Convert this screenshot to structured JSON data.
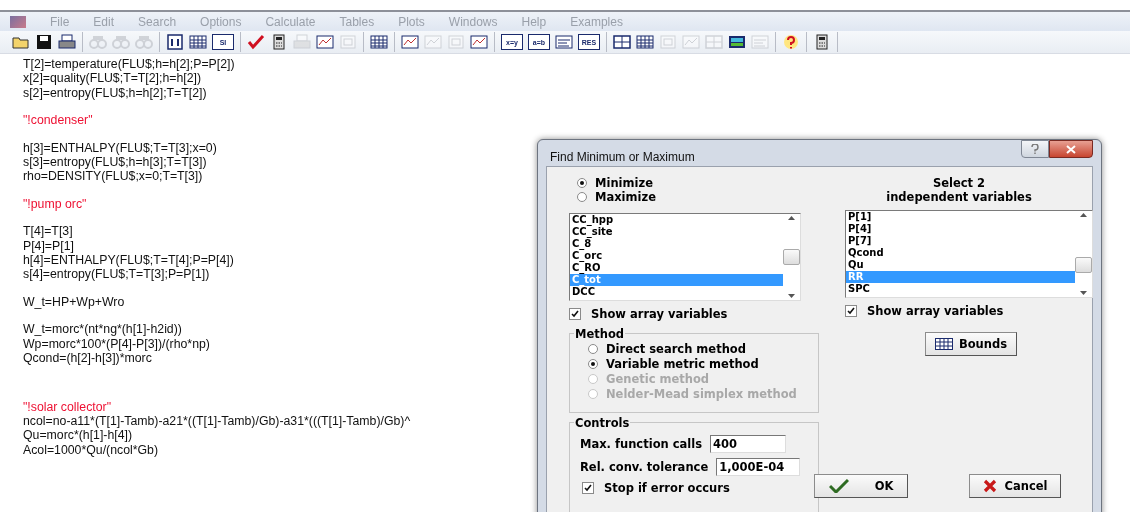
{
  "menu_bar": {
    "items": [
      "File",
      "Edit",
      "Search",
      "Options",
      "Calculate",
      "Tables",
      "Plots",
      "Windows",
      "Help",
      "Examples"
    ]
  },
  "toolbar": {
    "groups": [
      [
        {
          "kind": "folder",
          "disabled": false
        },
        {
          "kind": "disk",
          "disabled": false
        },
        {
          "kind": "printer",
          "disabled": false
        }
      ],
      [
        {
          "kind": "binoculars",
          "disabled": true
        },
        {
          "kind": "binoculars",
          "disabled": true
        },
        {
          "kind": "binoculars",
          "disabled": true
        }
      ],
      [
        {
          "kind": "dialog",
          "disabled": false
        },
        {
          "kind": "table",
          "disabled": false
        },
        {
          "kind": "labeled",
          "label": "SI",
          "disabled": false
        }
      ],
      [
        {
          "kind": "check",
          "disabled": false
        },
        {
          "kind": "calculator",
          "disabled": false
        },
        {
          "kind": "printer",
          "disabled": true
        },
        {
          "kind": "plot",
          "disabled": false
        },
        {
          "kind": "window",
          "disabled": true
        }
      ],
      [
        {
          "kind": "table",
          "disabled": false
        }
      ],
      [
        {
          "kind": "plot",
          "disabled": false
        },
        {
          "kind": "plot",
          "disabled": true
        },
        {
          "kind": "window",
          "disabled": true
        },
        {
          "kind": "plot",
          "disabled": false
        }
      ],
      [
        {
          "kind": "labeled",
          "label": "x=y",
          "disabled": false
        },
        {
          "kind": "labeled",
          "label": "a=b",
          "disabled": false
        },
        {
          "kind": "lines",
          "disabled": false
        },
        {
          "kind": "labeled",
          "label": "RES",
          "disabled": false
        }
      ],
      [
        {
          "kind": "grid",
          "disabled": false
        },
        {
          "kind": "table",
          "disabled": false
        },
        {
          "kind": "window",
          "disabled": true
        },
        {
          "kind": "plot",
          "disabled": true
        },
        {
          "kind": "grid",
          "disabled": true
        },
        {
          "kind": "picture",
          "disabled": false
        },
        {
          "kind": "lines",
          "disabled": true
        }
      ],
      [
        {
          "kind": "help",
          "disabled": false
        }
      ],
      [
        {
          "kind": "calculator",
          "disabled": false
        }
      ]
    ]
  },
  "code_blocks": [
    {
      "kind": "code",
      "lines": [
        "T[2]=temperature(FLU$;h=h[2];P=P[2])",
        "x[2]=quality(FLU$;T=T[2];h=h[2])",
        "s[2]=entropy(FLU$;h=h[2];T=T[2])"
      ]
    },
    {
      "kind": "comment",
      "lines": [
        "\"!condenser\""
      ]
    },
    {
      "kind": "code",
      "lines": [
        "h[3]=ENTHALPY(FLU$;T=T[3];x=0)",
        "s[3]=entropy(FLU$;h=h[3];T=T[3])",
        "rho=DENSITY(FLU$;x=0;T=T[3])"
      ]
    },
    {
      "kind": "comment",
      "lines": [
        "\"!pump orc\""
      ]
    },
    {
      "kind": "code",
      "lines": [
        "T[4]=T[3]",
        "P[4]=P[1]",
        "h[4]=ENTHALPY(FLU$;T=T[4];P=P[4])",
        "s[4]=entropy(FLU$;T=T[3];P=P[1])"
      ]
    },
    {
      "kind": "code",
      "lines": [
        "W_t=HP+Wp+Wro"
      ]
    },
    {
      "kind": "code",
      "lines": [
        "W_t=morc*(nt*ng*(h[1]-h2id))",
        "Wp=morc*100*(P[4]-P[3])/(rho*np)",
        "Qcond=(h[2]-h[3])*morc"
      ]
    },
    {
      "kind": "comment",
      "lines": [
        "\"!solar collector\""
      ]
    },
    {
      "kind": "code",
      "lines": [
        "ncol=no-a11*(T[1]-Tamb)-a21*((T[1]-Tamb)/Gb)-a31*(((T[1]-Tamb)/Gb)^",
        "Qu=morc*(h[1]-h[4])",
        "Acol=1000*Qu/(ncol*Gb)"
      ]
    }
  ],
  "dialog": {
    "title": "Find Minimum or Maximum",
    "objective": [
      {
        "label": "Minimize",
        "selected": true
      },
      {
        "label": "Maximize",
        "selected": false
      }
    ],
    "select_title": [
      "Select 2",
      "independent variables"
    ],
    "objective_list": {
      "items": [
        {
          "label": "CC_hpp",
          "selected": false
        },
        {
          "label": "CC_site",
          "selected": false
        },
        {
          "label": "C_8",
          "selected": false
        },
        {
          "label": "C_orc",
          "selected": false
        },
        {
          "label": "C_RO",
          "selected": false
        },
        {
          "label": "C_tot",
          "selected": true
        },
        {
          "label": "DCC",
          "selected": false
        }
      ],
      "show_arrays": {
        "label": "Show array variables",
        "checked": true
      }
    },
    "variable_list": {
      "items": [
        {
          "label": "P[1]",
          "selected": false
        },
        {
          "label": "P[4]",
          "selected": false
        },
        {
          "label": "P[7]",
          "selected": false
        },
        {
          "label": "Qcond",
          "selected": false
        },
        {
          "label": "Qu",
          "selected": false
        },
        {
          "label": "RR",
          "selected": true
        },
        {
          "label": "SPC",
          "selected": false
        }
      ],
      "show_arrays": {
        "label": "Show array variables",
        "checked": true
      }
    },
    "method": {
      "title": "Method",
      "options": [
        {
          "label": "Direct search method",
          "selected": false,
          "disabled": false
        },
        {
          "label": "Variable metric method",
          "selected": true,
          "disabled": false
        },
        {
          "label": "Genetic method",
          "selected": false,
          "disabled": true
        },
        {
          "label": "Nelder-Mead simplex method",
          "selected": false,
          "disabled": true
        }
      ]
    },
    "bounds_button": "Bounds",
    "controls": {
      "title": "Controls",
      "fields": [
        {
          "label": "Max. function calls",
          "value": "400"
        },
        {
          "label": "Rel. conv. tolerance",
          "value": "1,000E-04"
        }
      ],
      "stop_on_error": {
        "label": "Stop if error occurs",
        "checked": true
      }
    },
    "ok_button": "OK",
    "cancel_button": "Cancel"
  }
}
